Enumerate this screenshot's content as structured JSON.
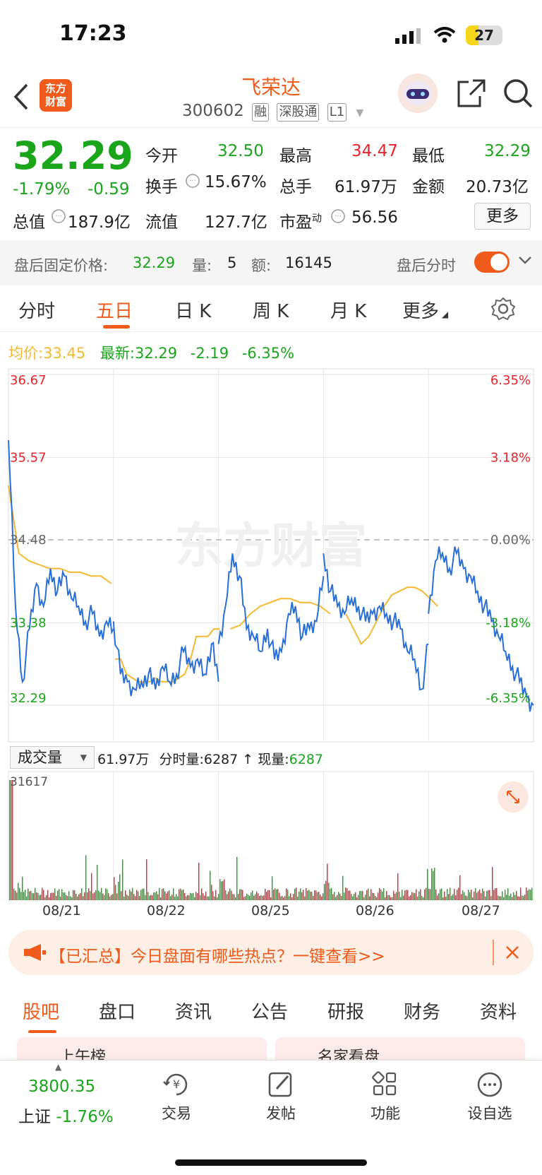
{
  "status": {
    "time": "17:23",
    "battery": "27"
  },
  "header": {
    "logo_line1": "东方",
    "logo_line2": "财富",
    "stock_name": "飞荣达",
    "stock_code": "300602",
    "tags": [
      "融",
      "深股通",
      "L1"
    ]
  },
  "quote": {
    "price": "32.29",
    "change_pct": "-1.79%",
    "change": "-0.59",
    "total_value_label": "总值",
    "total_value": "187.9亿",
    "cells": [
      {
        "label": "今开",
        "value": "32.50"
      },
      {
        "label": "最高",
        "value": "34.47"
      },
      {
        "label": "最低",
        "value": "32.29"
      },
      {
        "label": "换手",
        "value": "15.67%"
      },
      {
        "label": "总手",
        "value": "61.97万"
      },
      {
        "label": "金额",
        "value": "20.73亿"
      },
      {
        "label": "流值",
        "value": "127.7亿"
      },
      {
        "label": "市盈",
        "sup": "动",
        "value": "56.56"
      }
    ],
    "more_label": "更多"
  },
  "after_hours": {
    "label": "盘后固定价格:",
    "price": "32.29",
    "vol_label": "量:",
    "vol": "5",
    "amt_label": "额:",
    "amt": "16145",
    "timeshare_label": "盘后分时"
  },
  "tabs": [
    "分时",
    "五日",
    "日 K",
    "周 K",
    "月 K",
    "更多"
  ],
  "active_tab": "五日",
  "avg_line": {
    "avg_label": "均价:",
    "avg": "33.45",
    "latest_label": "最新:",
    "latest": "32.29",
    "change": "-2.19",
    "change_pct": "-6.35%"
  },
  "watermark": "东方财富",
  "volume_bar": {
    "selector": "成交量",
    "total": "61.97万",
    "tick_label": "分时量:",
    "tick": "6287",
    "now_label": "现量:",
    "now": "6287",
    "max": "31617"
  },
  "dates": [
    "08/21",
    "08/22",
    "08/25",
    "08/26",
    "08/27"
  ],
  "banner": {
    "text": "【已汇总】今日盘面有哪些热点？一键查看>>"
  },
  "section_tabs": [
    "股吧",
    "盘口",
    "资讯",
    "公告",
    "研报",
    "财务",
    "资料"
  ],
  "peek": [
    "上午榜",
    "名家看盘"
  ],
  "bottom_bar": {
    "index_value": "3800.35",
    "index_name": "上证",
    "index_change": "-1.76%",
    "items": [
      "交易",
      "发帖",
      "功能",
      "设自选"
    ]
  },
  "colors": {
    "accent": "#f05a1a",
    "up": "#e8242c",
    "down": "#1aa51a",
    "price_line": "#2a6fd6",
    "avg_line": "#f5b830"
  },
  "chart_data": {
    "type": "line",
    "x": [
      "08/21",
      "08/22",
      "08/25",
      "08/26",
      "08/27"
    ],
    "ylim": [
      32.29,
      36.67
    ],
    "y_ticks_left": [
      "36.67",
      "35.57",
      "34.48",
      "33.38",
      "32.29"
    ],
    "y_ticks_right": [
      "6.35%",
      "3.18%",
      "0.00%",
      "-3.18%",
      "-6.35%"
    ],
    "series": [
      {
        "values": [
          [
            35.8,
            33.6,
            32.6,
            33.3,
            33.9,
            33.6,
            34.1,
            33.8,
            34.0,
            33.7,
            33.6,
            33.4,
            33.5,
            33.2,
            33.4,
            33.3
          ],
          [
            33.4,
            32.7,
            32.6,
            32.5,
            32.6,
            32.7,
            32.5,
            32.8,
            32.6,
            32.7,
            33.0,
            32.8,
            32.9,
            32.7,
            33.1,
            32.6
          ],
          [
            33.1,
            33.6,
            34.3,
            34.0,
            33.3,
            33.2,
            33.0,
            33.3,
            32.9,
            33.0,
            33.5,
            33.6,
            33.2,
            33.3,
            33.4,
            34.0
          ],
          [
            34.3,
            33.8,
            33.6,
            33.5,
            33.7,
            33.6,
            33.4,
            33.5,
            33.6,
            33.5,
            33.4,
            33.3,
            33.0,
            32.9,
            32.5,
            33.1
          ],
          [
            33.5,
            34.2,
            34.3,
            34.1,
            34.3,
            34.1,
            34.0,
            33.8,
            33.6,
            33.4,
            33.2,
            33.0,
            32.8,
            32.6,
            32.4,
            32.29
          ]
        ]
      },
      {
        "values": [
          [
            35.2,
            34.3,
            34.2,
            34.15,
            34.1,
            34.1,
            34.05,
            34.05,
            34.0,
            34.0,
            33.9
          ],
          [
            32.9,
            32.9,
            32.7,
            32.65,
            32.6,
            32.6,
            32.6,
            32.65,
            32.6,
            32.6,
            32.6,
            32.65,
            32.7,
            32.9,
            33.2,
            33.2,
            33.2,
            33.3,
            33.3
          ],
          [
            33.3,
            33.35,
            33.5,
            33.6,
            33.65,
            33.7,
            33.7,
            33.65,
            33.65,
            33.6,
            33.5
          ],
          [
            33.5,
            33.3,
            33.1,
            33.2,
            33.4,
            33.6,
            33.75,
            33.8,
            33.85,
            33.85,
            33.8,
            33.7,
            33.6
          ]
        ]
      }
    ]
  }
}
